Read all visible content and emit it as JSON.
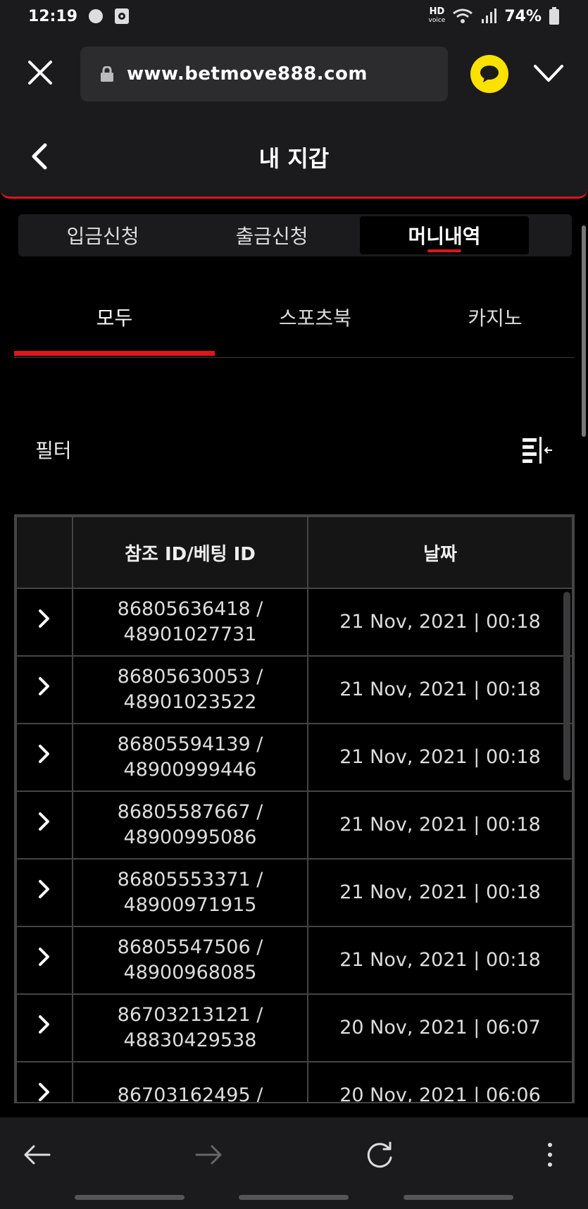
{
  "status_bar": {
    "time": "12:19",
    "hd_label": "HD",
    "voice_label": "voice",
    "battery": "74%"
  },
  "browser": {
    "url": "www.betmove888.com"
  },
  "header": {
    "title": "내 지갑"
  },
  "top_tabs": [
    {
      "label": "입금신청",
      "active": false
    },
    {
      "label": "출금신청",
      "active": false
    },
    {
      "label": "머니내역",
      "active": true
    }
  ],
  "sub_tabs": [
    {
      "label": "모두",
      "active": true
    },
    {
      "label": "스포츠북",
      "active": false
    },
    {
      "label": "카지노",
      "active": false
    }
  ],
  "filter": {
    "label": "필터"
  },
  "table": {
    "columns": [
      "",
      "참조 ID/베팅 ID",
      "날짜"
    ],
    "rows": [
      {
        "ref": "86805636418 /",
        "bet": "48901027731",
        "date": "21 Nov, 2021 | 00:18"
      },
      {
        "ref": "86805630053 /",
        "bet": "48901023522",
        "date": "21 Nov, 2021 | 00:18"
      },
      {
        "ref": "86805594139 /",
        "bet": "48900999446",
        "date": "21 Nov, 2021 | 00:18"
      },
      {
        "ref": "86805587667 /",
        "bet": "48900995086",
        "date": "21 Nov, 2021 | 00:18"
      },
      {
        "ref": "86805553371 /",
        "bet": "48900971915",
        "date": "21 Nov, 2021 | 00:18"
      },
      {
        "ref": "86805547506 /",
        "bet": "48900968085",
        "date": "21 Nov, 2021 | 00:18"
      },
      {
        "ref": "86703213121 /",
        "bet": "48830429538",
        "date": "20 Nov, 2021 | 06:07"
      },
      {
        "ref": "86703162495 /",
        "bet": "",
        "date": "20 Nov, 2021 | 06:06"
      }
    ]
  },
  "colors": {
    "accent": "#e0141e",
    "kakao": "#fae100",
    "bar_bg": "#1b1b1d"
  }
}
